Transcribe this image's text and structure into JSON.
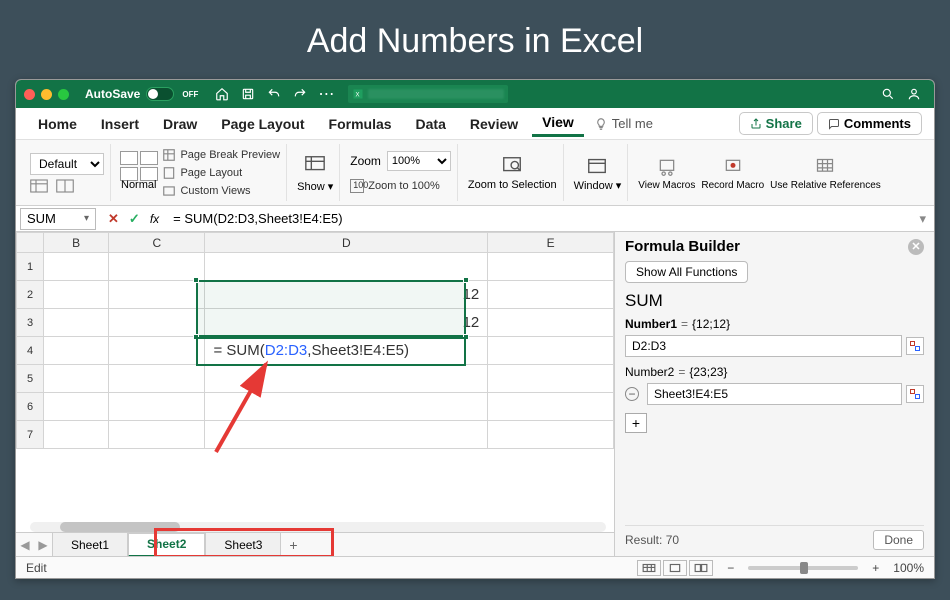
{
  "page_title": "Add Numbers in Excel",
  "titlebar": {
    "autosave_label": "AutoSave",
    "autosave_state": "OFF"
  },
  "ribbon": {
    "tabs": [
      "Home",
      "Insert",
      "Draw",
      "Page Layout",
      "Formulas",
      "Data",
      "Review",
      "View"
    ],
    "active_tab": "View",
    "tell_me": "Tell me",
    "share": "Share",
    "comments": "Comments",
    "style_select": "Default",
    "normal": "Normal",
    "views": [
      "Page Break Preview",
      "Page Layout",
      "Custom Views"
    ],
    "show": "Show",
    "zoom_label": "Zoom",
    "zoom_value": "100%",
    "zoom_100": "Zoom to 100%",
    "zoom_selection": "Zoom to Selection",
    "window": "Window",
    "macros": [
      "View Macros",
      "Record Macro",
      "Use Relative References"
    ]
  },
  "formula_bar": {
    "name": "SUM",
    "formula": "= SUM(D2:D3,Sheet3!E4:E5)"
  },
  "grid": {
    "columns": [
      "B",
      "C",
      "D",
      "E"
    ],
    "rows": [
      1,
      2,
      3,
      4,
      5,
      6,
      7
    ],
    "cells": {
      "D2": "12",
      "D3": "12"
    },
    "editing_cell": "D4",
    "editing_prefix": "= SUM(",
    "editing_highlight": "D2:D3",
    "editing_suffix": ",Sheet3!E4:E5)"
  },
  "builder": {
    "title": "Formula Builder",
    "show_all": "Show All Functions",
    "fn": "SUM",
    "args": [
      {
        "label": "Number1",
        "preview": "{12;12}",
        "value": "D2:D3",
        "bold": true,
        "minus": false
      },
      {
        "label": "Number2",
        "preview": "{23;23}",
        "value": "Sheet3!E4:E5",
        "bold": false,
        "minus": true
      }
    ],
    "result_label": "Result:",
    "result_value": "70",
    "done": "Done"
  },
  "sheets": {
    "tabs": [
      "Sheet1",
      "Sheet2",
      "Sheet3"
    ],
    "active": "Sheet2"
  },
  "status": {
    "mode": "Edit",
    "zoom": "100%"
  }
}
